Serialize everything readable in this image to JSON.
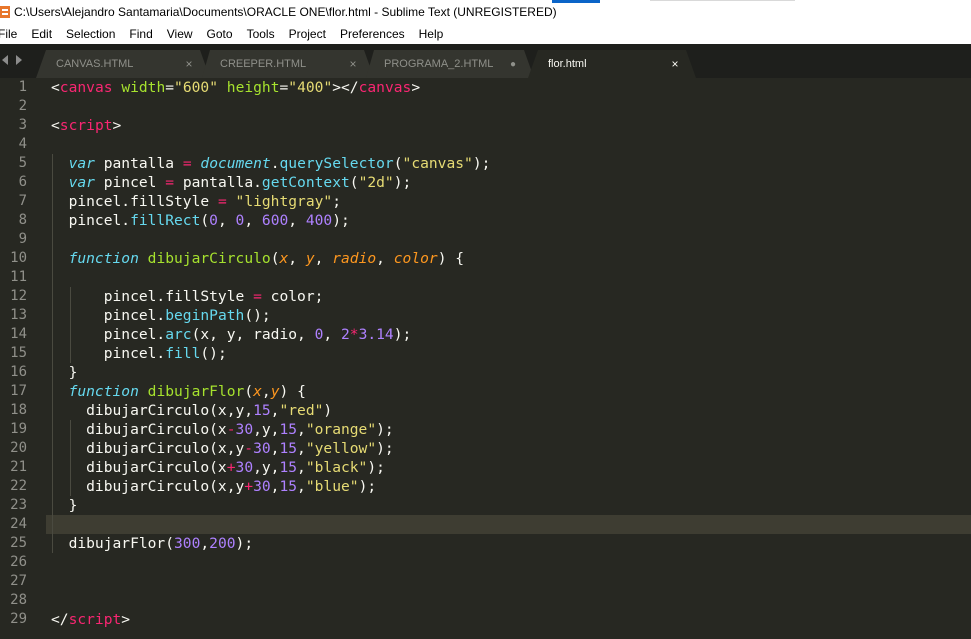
{
  "window": {
    "title": "C:\\Users\\Alejandro Santamaria\\Documents\\ORACLE ONE\\flor.html - Sublime Text (UNREGISTERED)"
  },
  "menu": [
    "File",
    "Edit",
    "Selection",
    "Find",
    "View",
    "Goto",
    "Tools",
    "Project",
    "Preferences",
    "Help"
  ],
  "tab_nav_icon": "tab-nav-arrows-icon",
  "tabs": [
    {
      "label": "CANVAS.HTML",
      "state": "close"
    },
    {
      "label": "CREEPER.HTML",
      "state": "close"
    },
    {
      "label": "PROGRAMA_2.HTML",
      "state": "modified"
    },
    {
      "label": "flor.html",
      "state": "close",
      "active": true
    }
  ],
  "tab_close_glyph": "×",
  "tab_modified_glyph": "●",
  "editor": {
    "current_line": 24,
    "line_numbers": [
      "1",
      "2",
      "3",
      "4",
      "5",
      "6",
      "7",
      "8",
      "9",
      "10",
      "11",
      "12",
      "13",
      "14",
      "15",
      "16",
      "17",
      "18",
      "19",
      "20",
      "21",
      "22",
      "23",
      "24",
      "25",
      "26",
      "27",
      "28",
      "29"
    ],
    "lines": [
      [
        [
          "t-plain",
          "<"
        ],
        [
          "t-tag",
          "canvas"
        ],
        [
          "t-plain",
          " "
        ],
        [
          "t-attr",
          "width"
        ],
        [
          "t-plain",
          "="
        ],
        [
          "t-str",
          "\"600\""
        ],
        [
          "t-plain",
          " "
        ],
        [
          "t-attr",
          "height"
        ],
        [
          "t-plain",
          "="
        ],
        [
          "t-str",
          "\"400\""
        ],
        [
          "t-plain",
          "></"
        ],
        [
          "t-tag",
          "canvas"
        ],
        [
          "t-plain",
          ">"
        ]
      ],
      [],
      [
        [
          "t-plain",
          "<"
        ],
        [
          "t-tag",
          "script"
        ],
        [
          "t-plain",
          ">"
        ]
      ],
      [],
      [
        [
          "t-plain",
          "  "
        ],
        [
          "t-kw",
          "var"
        ],
        [
          "t-plain",
          " pantalla "
        ],
        [
          "t-op",
          "="
        ],
        [
          "t-plain",
          " "
        ],
        [
          "t-obj",
          "document"
        ],
        [
          "t-plain",
          "."
        ],
        [
          "t-prop",
          "querySelector"
        ],
        [
          "t-plain",
          "("
        ],
        [
          "t-str",
          "\"canvas\""
        ],
        [
          "t-plain",
          ");"
        ]
      ],
      [
        [
          "t-plain",
          "  "
        ],
        [
          "t-kw",
          "var"
        ],
        [
          "t-plain",
          " pincel "
        ],
        [
          "t-op",
          "="
        ],
        [
          "t-plain",
          " pantalla."
        ],
        [
          "t-prop",
          "getContext"
        ],
        [
          "t-plain",
          "("
        ],
        [
          "t-str",
          "\"2d\""
        ],
        [
          "t-plain",
          ");"
        ]
      ],
      [
        [
          "t-plain",
          "  pincel.fillStyle "
        ],
        [
          "t-op",
          "="
        ],
        [
          "t-plain",
          " "
        ],
        [
          "t-str",
          "\"lightgray\""
        ],
        [
          "t-plain",
          ";"
        ]
      ],
      [
        [
          "t-plain",
          "  pincel."
        ],
        [
          "t-prop",
          "fillRect"
        ],
        [
          "t-plain",
          "("
        ],
        [
          "t-num",
          "0"
        ],
        [
          "t-plain",
          ", "
        ],
        [
          "t-num",
          "0"
        ],
        [
          "t-plain",
          ", "
        ],
        [
          "t-num",
          "600"
        ],
        [
          "t-plain",
          ", "
        ],
        [
          "t-num",
          "400"
        ],
        [
          "t-plain",
          ");"
        ]
      ],
      [],
      [
        [
          "t-plain",
          "  "
        ],
        [
          "t-kw",
          "function"
        ],
        [
          "t-plain",
          " "
        ],
        [
          "t-fn",
          "dibujarCirculo"
        ],
        [
          "t-plain",
          "("
        ],
        [
          "t-param",
          "x"
        ],
        [
          "t-plain",
          ", "
        ],
        [
          "t-param",
          "y"
        ],
        [
          "t-plain",
          ", "
        ],
        [
          "t-param",
          "radio"
        ],
        [
          "t-plain",
          ", "
        ],
        [
          "t-param",
          "color"
        ],
        [
          "t-plain",
          ") {"
        ]
      ],
      [],
      [
        [
          "t-plain",
          "      pincel.fillStyle "
        ],
        [
          "t-op",
          "="
        ],
        [
          "t-plain",
          " color;"
        ]
      ],
      [
        [
          "t-plain",
          "      pincel."
        ],
        [
          "t-prop",
          "beginPath"
        ],
        [
          "t-plain",
          "();"
        ]
      ],
      [
        [
          "t-plain",
          "      pincel."
        ],
        [
          "t-prop",
          "arc"
        ],
        [
          "t-plain",
          "(x, y, radio, "
        ],
        [
          "t-num",
          "0"
        ],
        [
          "t-plain",
          ", "
        ],
        [
          "t-num",
          "2"
        ],
        [
          "t-op",
          "*"
        ],
        [
          "t-num",
          "3.14"
        ],
        [
          "t-plain",
          ");"
        ]
      ],
      [
        [
          "t-plain",
          "      pincel."
        ],
        [
          "t-prop",
          "fill"
        ],
        [
          "t-plain",
          "();"
        ]
      ],
      [
        [
          "t-plain",
          "  }"
        ]
      ],
      [
        [
          "t-plain",
          "  "
        ],
        [
          "t-kw",
          "function"
        ],
        [
          "t-plain",
          " "
        ],
        [
          "t-fn",
          "dibujarFlor"
        ],
        [
          "t-plain",
          "("
        ],
        [
          "t-param",
          "x"
        ],
        [
          "t-plain",
          ","
        ],
        [
          "t-param",
          "y"
        ],
        [
          "t-plain",
          ") {"
        ]
      ],
      [
        [
          "t-plain",
          "    dibujarCirculo(x,y,"
        ],
        [
          "t-num",
          "15"
        ],
        [
          "t-plain",
          ","
        ],
        [
          "t-str",
          "\"red\""
        ],
        [
          "t-plain",
          ")"
        ]
      ],
      [
        [
          "t-plain",
          "    dibujarCirculo(x"
        ],
        [
          "t-op",
          "-"
        ],
        [
          "t-num",
          "30"
        ],
        [
          "t-plain",
          ",y,"
        ],
        [
          "t-num",
          "15"
        ],
        [
          "t-plain",
          ","
        ],
        [
          "t-str",
          "\"orange\""
        ],
        [
          "t-plain",
          ");"
        ]
      ],
      [
        [
          "t-plain",
          "    dibujarCirculo(x,y"
        ],
        [
          "t-op",
          "-"
        ],
        [
          "t-num",
          "30"
        ],
        [
          "t-plain",
          ","
        ],
        [
          "t-num",
          "15"
        ],
        [
          "t-plain",
          ","
        ],
        [
          "t-str",
          "\"yellow\""
        ],
        [
          "t-plain",
          ");"
        ]
      ],
      [
        [
          "t-plain",
          "    dibujarCirculo(x"
        ],
        [
          "t-op",
          "+"
        ],
        [
          "t-num",
          "30"
        ],
        [
          "t-plain",
          ",y,"
        ],
        [
          "t-num",
          "15"
        ],
        [
          "t-plain",
          ","
        ],
        [
          "t-str",
          "\"black\""
        ],
        [
          "t-plain",
          ");"
        ]
      ],
      [
        [
          "t-plain",
          "    dibujarCirculo(x,y"
        ],
        [
          "t-op",
          "+"
        ],
        [
          "t-num",
          "30"
        ],
        [
          "t-plain",
          ","
        ],
        [
          "t-num",
          "15"
        ],
        [
          "t-plain",
          ","
        ],
        [
          "t-str",
          "\"blue\""
        ],
        [
          "t-plain",
          ");"
        ]
      ],
      [
        [
          "t-plain",
          "  }"
        ]
      ],
      [],
      [
        [
          "t-plain",
          "  dibujarFlor("
        ],
        [
          "t-num",
          "300"
        ],
        [
          "t-plain",
          ","
        ],
        [
          "t-num",
          "200"
        ],
        [
          "t-plain",
          ");"
        ]
      ],
      [],
      [],
      [],
      [
        [
          "t-plain",
          "</"
        ],
        [
          "t-tag",
          "script"
        ],
        [
          "t-plain",
          ">"
        ]
      ]
    ]
  },
  "colors": {
    "editor_bg": "#272822",
    "tag": "#f92672",
    "attribute": "#a6e22e",
    "string": "#e6db74",
    "keyword": "#66d9ef",
    "number": "#ae81ff",
    "parameter": "#fd971f"
  }
}
